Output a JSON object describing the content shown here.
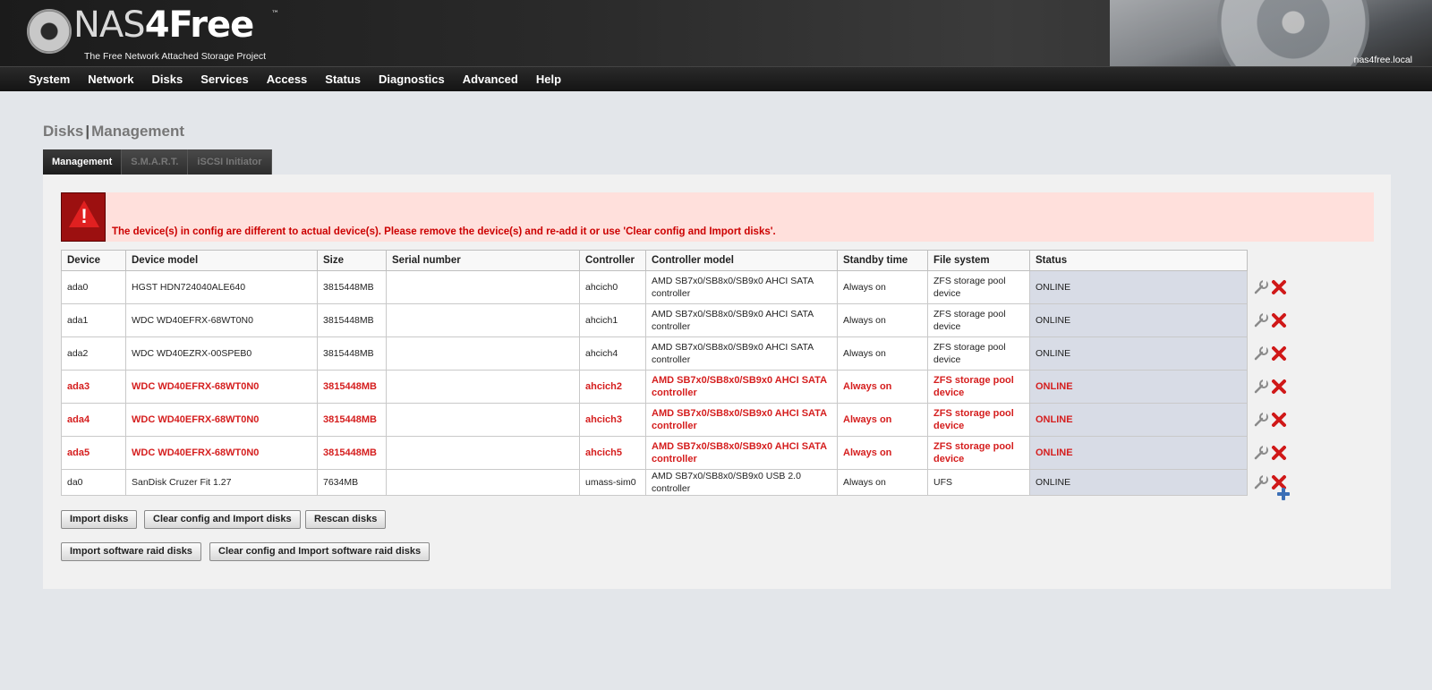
{
  "header": {
    "logo_main": "NAS",
    "logo_four": "4",
    "logo_free": "Free",
    "logo_tm": "™",
    "tagline": "The Free Network Attached Storage Project",
    "hostname": "nas4free.local"
  },
  "nav": [
    "System",
    "Network",
    "Disks",
    "Services",
    "Access",
    "Status",
    "Diagnostics",
    "Advanced",
    "Help"
  ],
  "page": {
    "title_part1": "Disks",
    "title_sep": "|",
    "title_part2": "Management"
  },
  "tabs": [
    {
      "label": "Management",
      "active": true
    },
    {
      "label": "S.M.A.R.T.",
      "active": false
    },
    {
      "label": "iSCSI Initiator",
      "active": false
    }
  ],
  "error": {
    "message": "The device(s) in config are different to actual device(s). Please remove the device(s) and re-add it or use 'Clear config and Import disks'."
  },
  "table": {
    "headers": [
      "Device",
      "Device model",
      "Size",
      "Serial number",
      "Controller",
      "Controller model",
      "Standby time",
      "File system",
      "Status"
    ],
    "rows": [
      {
        "device": "ada0",
        "model": "HGST HDN724040ALE640",
        "size": "3815448MB",
        "serial": "",
        "controller": "ahcich0",
        "controller_model": "AMD SB7x0/SB8x0/SB9x0 AHCI SATA controller",
        "standby": "Always on",
        "fs": "ZFS storage pool device",
        "status": "ONLINE",
        "error": false
      },
      {
        "device": "ada1",
        "model": "WDC WD40EFRX-68WT0N0",
        "size": "3815448MB",
        "serial": "",
        "controller": "ahcich1",
        "controller_model": "AMD SB7x0/SB8x0/SB9x0 AHCI SATA controller",
        "standby": "Always on",
        "fs": "ZFS storage pool device",
        "status": "ONLINE",
        "error": false
      },
      {
        "device": "ada2",
        "model": "WDC WD40EZRX-00SPEB0",
        "size": "3815448MB",
        "serial": "",
        "controller": "ahcich4",
        "controller_model": "AMD SB7x0/SB8x0/SB9x0 AHCI SATA controller",
        "standby": "Always on",
        "fs": "ZFS storage pool device",
        "status": "ONLINE",
        "error": false
      },
      {
        "device": "ada3",
        "model": "WDC WD40EFRX-68WT0N0",
        "size": "3815448MB",
        "serial": "",
        "controller": "ahcich2",
        "controller_model": "AMD SB7x0/SB8x0/SB9x0 AHCI SATA controller",
        "standby": "Always on",
        "fs": "ZFS storage pool device",
        "status": "ONLINE",
        "error": true
      },
      {
        "device": "ada4",
        "model": "WDC WD40EFRX-68WT0N0",
        "size": "3815448MB",
        "serial": "",
        "controller": "ahcich3",
        "controller_model": "AMD SB7x0/SB8x0/SB9x0 AHCI SATA controller",
        "standby": "Always on",
        "fs": "ZFS storage pool device",
        "status": "ONLINE",
        "error": true
      },
      {
        "device": "ada5",
        "model": "WDC WD40EFRX-68WT0N0",
        "size": "3815448MB",
        "serial": "",
        "controller": "ahcich5",
        "controller_model": "AMD SB7x0/SB8x0/SB9x0 AHCI SATA controller",
        "standby": "Always on",
        "fs": "ZFS storage pool device",
        "status": "ONLINE",
        "error": true
      },
      {
        "device": "da0",
        "model": "SanDisk Cruzer Fit 1.27",
        "size": "7634MB",
        "serial": "",
        "controller": "umass-sim0",
        "controller_model": "AMD SB7x0/SB8x0/SB9x0 USB 2.0 controller",
        "standby": "Always on",
        "fs": "UFS",
        "status": "ONLINE",
        "error": false
      }
    ]
  },
  "buttons": {
    "import_disks": "Import disks",
    "clear_import": "Clear config and Import disks",
    "rescan": "Rescan disks",
    "import_raid": "Import software raid disks",
    "clear_import_raid": "Clear config and Import software raid disks"
  },
  "icons": {
    "edit": "wrench-icon",
    "delete": "red-x-icon",
    "add": "blue-plus-icon",
    "error": "warning-triangle-icon"
  },
  "colors": {
    "error_text": "#d51e1e",
    "error_bg": "#ffe0dc",
    "status_cell_bg": "#d8dce6"
  }
}
